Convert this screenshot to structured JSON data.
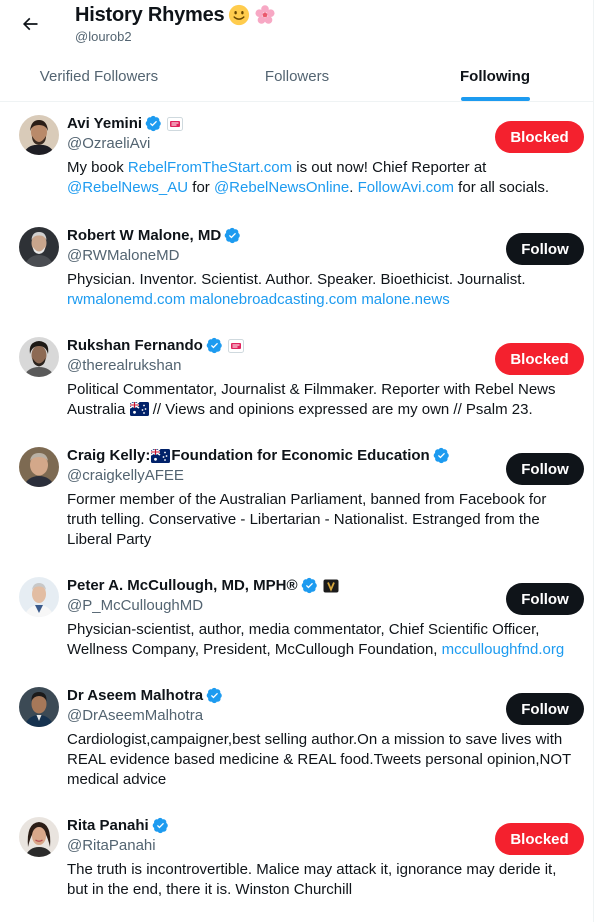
{
  "header": {
    "title": "History Rhymes",
    "handle": "@lourob2"
  },
  "tabs": [
    {
      "label": "Verified Followers"
    },
    {
      "label": "Followers"
    },
    {
      "label": "Following"
    }
  ],
  "colors": {
    "accent": "#1d9bf0",
    "blocked": "#f4212e",
    "follow": "#0f1419",
    "secondary_text": "#536471"
  },
  "users": [
    {
      "name": "Avi Yemini",
      "handle": "@OzraeliAvi",
      "button": "Blocked",
      "bio": {
        "t1": "My book ",
        "l1": "RebelFromTheStart.com",
        "t2": " is out now! Chief Reporter at ",
        "l2": "@RebelNews_AU",
        "t3": " for ",
        "l3": "@RebelNewsOnline",
        "t4": ". ",
        "l4": "FollowAvi.com",
        "t5": " for all socials."
      }
    },
    {
      "name": "Robert W Malone, MD",
      "handle": "@RWMaloneMD",
      "button": "Follow",
      "bio": {
        "t1": "Physician. Inventor. Scientist. Author. Speaker. Bioethicist. Journalist.",
        "l1": "rwmalonemd.com",
        "l2": "malonebroadcasting.com",
        "l3": "malone.news"
      }
    },
    {
      "name": "Rukshan Fernando",
      "handle": "@therealrukshan",
      "button": "Blocked",
      "bio": {
        "t1": "Political Commentator, Journalist & Filmmaker. Reporter with Rebel News Australia ",
        "t2": " // Views and opinions expressed are my own // Psalm 23."
      }
    },
    {
      "name_a": "Craig Kelly:",
      "name_b": "Foundation for Economic Education",
      "handle": "@craigkellyAFEE",
      "button": "Follow",
      "bio": {
        "t1": "Former member of the Australian Parliament, banned from Facebook for truth telling. Conservative - Libertarian - Nationalist. Estranged from the Liberal Party"
      }
    },
    {
      "name": "Peter A. McCullough, MD, MPH®",
      "handle": "@P_McCulloughMD",
      "button": "Follow",
      "bio": {
        "t1": "Physician-scientist, author, media commentator, Chief Scientific Officer, Wellness Company, President, McCullough Foundation, ",
        "l1": "mcculloughfnd.org"
      }
    },
    {
      "name": "Dr Aseem Malhotra",
      "handle": "@DrAseemMalhotra",
      "button": "Follow",
      "bio": {
        "t1": "Cardiologist,campaigner,best selling author.On a mission to save lives with REAL evidence based medicine & REAL food.Tweets personal opinion,NOT medical advice"
      }
    },
    {
      "name": "Rita Panahi",
      "handle": "@RitaPanahi",
      "button": "Blocked",
      "bio": {
        "t1": "The truth is incontrovertible. Malice may attack it, ignorance may deride it, but in the end, there it is. Winston Churchill"
      }
    }
  ]
}
